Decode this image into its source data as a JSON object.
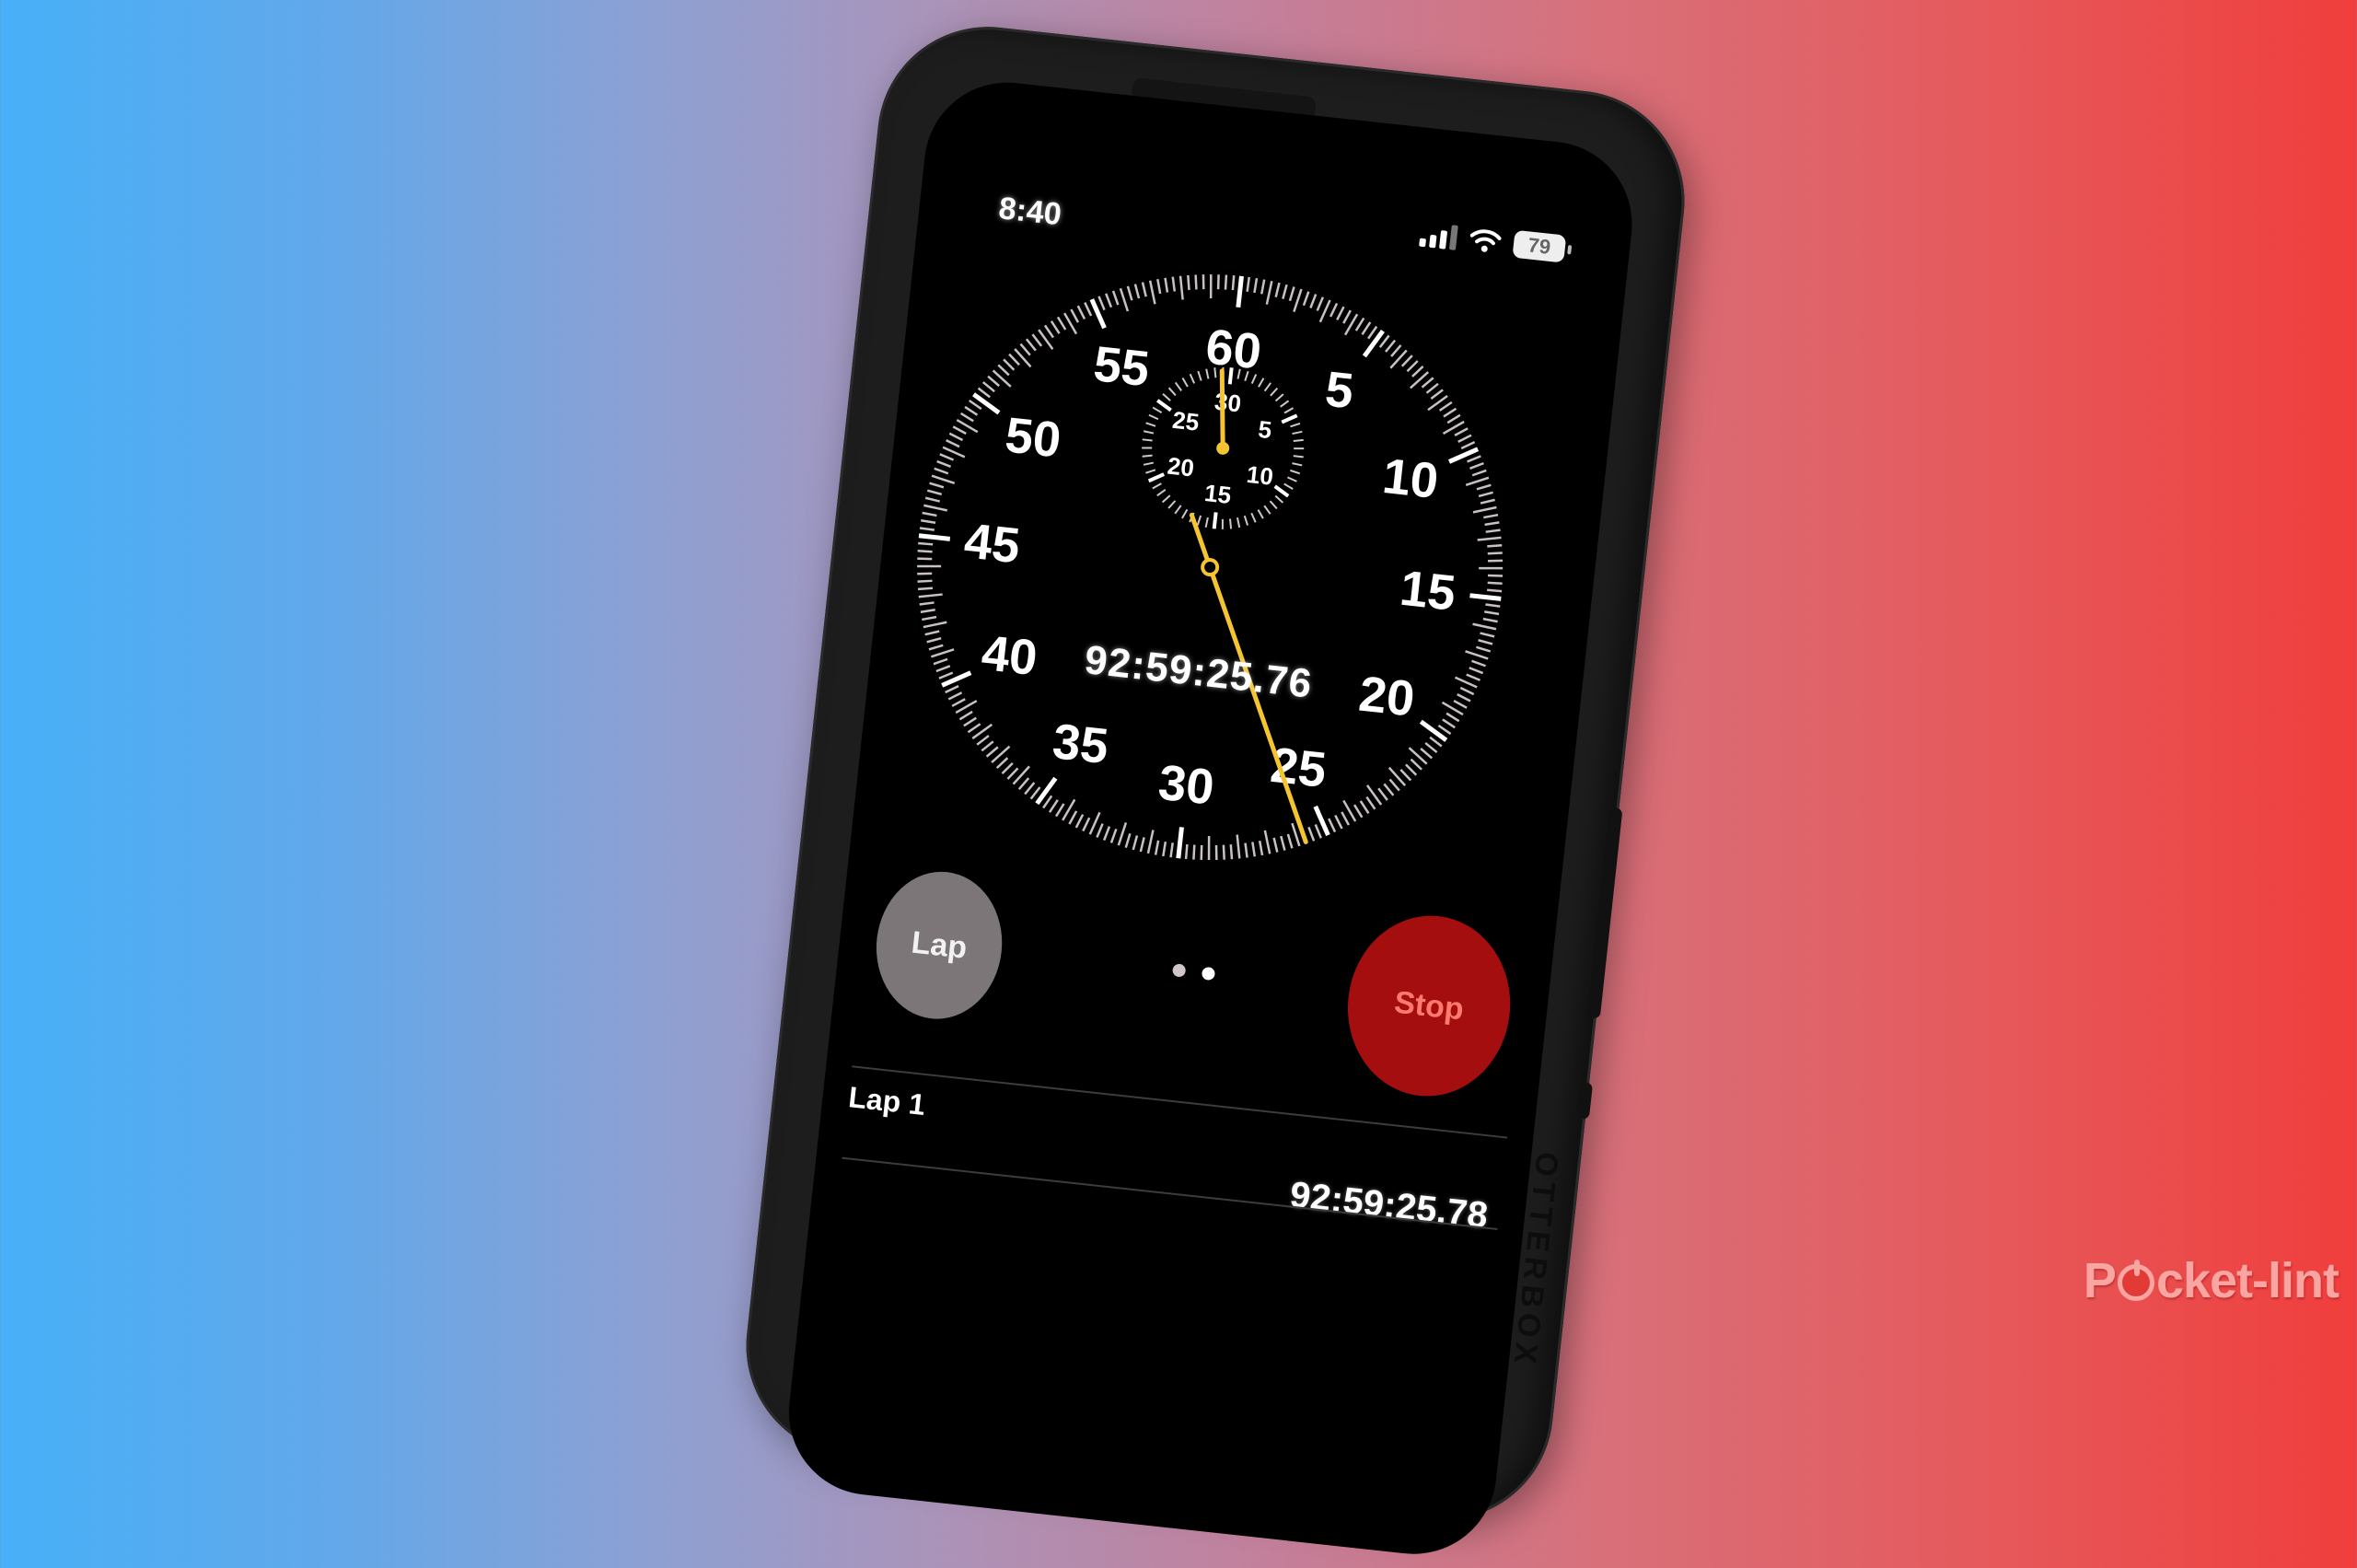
{
  "status_bar": {
    "time": "8:40",
    "signal_icon": "cellular-signal-icon",
    "wifi_icon": "wifi-icon",
    "battery_level": "79"
  },
  "stopwatch": {
    "elapsed": "92:59:25.76",
    "main_dial": {
      "labels": [
        "60",
        "5",
        "10",
        "15",
        "20",
        "25",
        "30",
        "35",
        "40",
        "45",
        "50",
        "55"
      ],
      "second_hand_value_seconds": 25.76
    },
    "sub_dial": {
      "labels": [
        "30",
        "5",
        "10",
        "15",
        "20",
        "25"
      ],
      "minute_hand_value_minutes": 29.43
    },
    "hand_color": "#f5c431",
    "lap_button_label": "Lap",
    "stop_button_label": "Stop",
    "stop_button_color": "#a40e0e",
    "page_indicator": {
      "pages": 2,
      "active": 2
    }
  },
  "laps": [
    {
      "label": "Lap 1",
      "time": "92:59:25.78"
    }
  ],
  "case_brand": "OTTERBOX",
  "watermark": {
    "prefix": "P",
    "suffix": "cket-lint"
  }
}
